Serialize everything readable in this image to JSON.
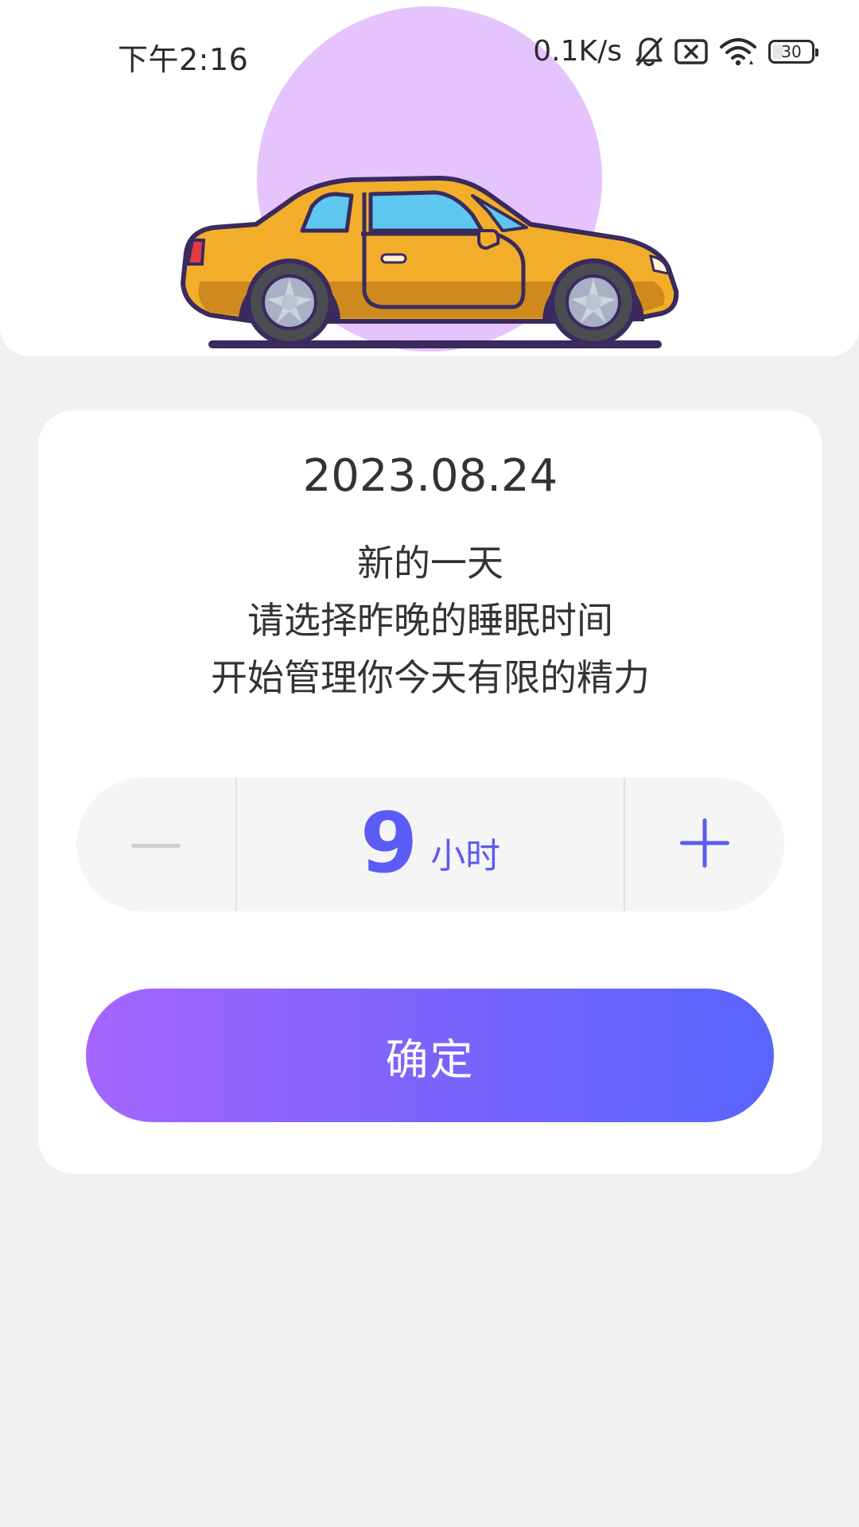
{
  "status_bar": {
    "time": "下午2:16",
    "net_speed": "0.1K/s",
    "battery": "30",
    "battery_level_percent": 30,
    "icons": [
      "bell-off-icon",
      "sim-error-icon",
      "wifi-icon",
      "battery-icon"
    ]
  },
  "header": {
    "illustration": "car-illustration",
    "accent_circle_color": "#e5c3fd"
  },
  "card": {
    "date": "2023.08.24",
    "line1": "新的一天",
    "line2": "请选择昨晚的睡眠时间",
    "line3": "开始管理你今天有限的精力"
  },
  "stepper": {
    "value": "9",
    "unit": "小时",
    "accent_color": "#5b5bf5"
  },
  "confirm_button": {
    "label": "确定",
    "gradient": [
      "#a465fd",
      "#5865fd"
    ]
  }
}
